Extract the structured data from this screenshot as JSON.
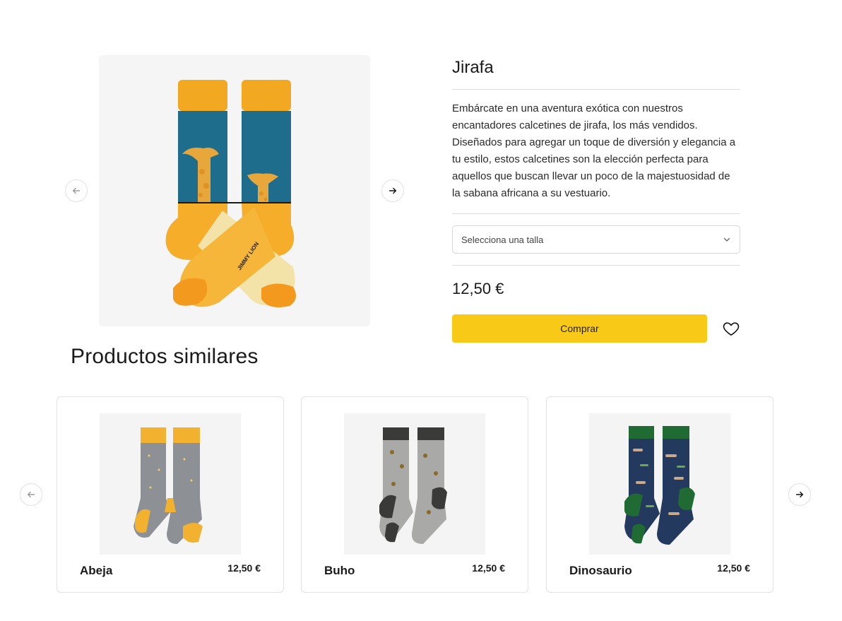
{
  "product": {
    "title": "Jirafa",
    "description": "Embárcate en una aventura exótica con nuestros encantadores calcetines de jirafa, los más vendidos. Diseñados para agregar un toque de diversión y elegancia a tu estilo, estos calcetines son la elección perfecta para aquellos que buscan llevar un poco de la majestuosidad de la sabana africana a su vestuario.",
    "size_placeholder": "Selecciona una talla",
    "price": "12,50 €",
    "buy_label": "Comprar",
    "brand_print": "JIMMY LION"
  },
  "similar": {
    "title": "Productos similares",
    "items": [
      {
        "name": "Abeja",
        "price": "12,50 €",
        "cuff": "#f2b230",
        "body": "#8d9196",
        "pattern": "bee"
      },
      {
        "name": "Buho",
        "price": "12,50 €",
        "cuff": "#3a3a38",
        "body": "#a9a9a7",
        "pattern": "owl"
      },
      {
        "name": "Dinosaurio",
        "price": "12,50 €",
        "cuff": "#1f6b33",
        "body": "#233a5e",
        "pattern": "dino"
      }
    ]
  },
  "colors": {
    "accent": "#f8ca17",
    "giraffe_blue": "#1e6d8c",
    "giraffe_yellow": "#f5ad2a"
  },
  "icons": [
    "arrow-left-icon",
    "arrow-right-icon",
    "chevron-down-icon",
    "heart-icon"
  ]
}
